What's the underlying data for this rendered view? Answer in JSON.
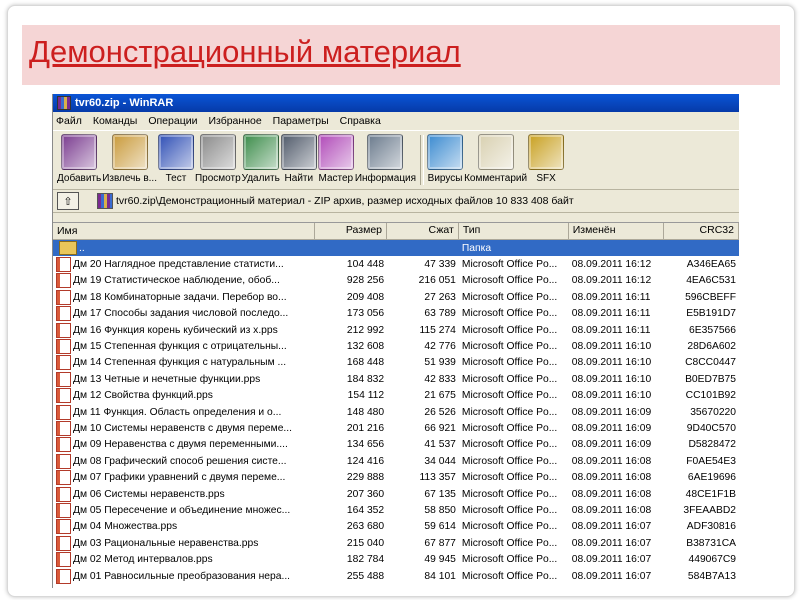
{
  "slide": {
    "title": "Демонстрационный материал"
  },
  "window": {
    "title": "tvr60.zip - WinRAR"
  },
  "menu": [
    "Файл",
    "Команды",
    "Операции",
    "Избранное",
    "Параметры",
    "Справка"
  ],
  "toolbar": [
    {
      "label": "Добавить",
      "icon": "add-archive-icon",
      "color": "#7a3b8f"
    },
    {
      "label": "Извлечь в...",
      "icon": "extract-icon",
      "color": "#c99a3a"
    },
    {
      "label": "Тест",
      "icon": "test-icon",
      "color": "#2f4fb5"
    },
    {
      "label": "Просмотр",
      "icon": "view-icon",
      "color": "#8a8a8a"
    },
    {
      "label": "Удалить",
      "icon": "delete-icon",
      "color": "#3c8c4a"
    },
    {
      "label": "Найти",
      "icon": "find-icon",
      "color": "#505a6a"
    },
    {
      "label": "Мастер",
      "icon": "wizard-icon",
      "color": "#b04ab8"
    },
    {
      "label": "Информация",
      "icon": "info-icon",
      "color": "#6a7a8c"
    },
    {
      "label": "Вирусы",
      "icon": "virus-icon",
      "color": "#3a8ad0"
    },
    {
      "label": "Комментарий",
      "icon": "comment-icon",
      "color": "#d8d0b0"
    },
    {
      "label": "SFX",
      "icon": "sfx-icon",
      "color": "#c8a020"
    }
  ],
  "address": {
    "up_label": "⇧",
    "path": "tvr60.zip\\Демонстрационный материал - ZIP архив, размер исходных файлов 10 833 408 байт"
  },
  "columns": {
    "name": "Имя",
    "size": "Размер",
    "packed": "Сжат",
    "type": "Тип",
    "modified": "Изменён",
    "crc": "CRC32"
  },
  "parent_row": {
    "name": "..",
    "type": "Папка"
  },
  "files": [
    {
      "name": "Дм 20 Наглядное представление статисти...",
      "size": "104 448",
      "packed": "47 339",
      "type": "Microsoft Office Po...",
      "modified": "08.09.2011 16:12",
      "crc": "A346EA65"
    },
    {
      "name": "Дм 19 Статистическое наблюдение, обоб...",
      "size": "928 256",
      "packed": "216 051",
      "type": "Microsoft Office Po...",
      "modified": "08.09.2011 16:12",
      "crc": "4EA6C531"
    },
    {
      "name": "Дм 18 Комбинаторные задачи. Перебор во...",
      "size": "209 408",
      "packed": "27 263",
      "type": "Microsoft Office Po...",
      "modified": "08.09.2011 16:11",
      "crc": "596CBEFF"
    },
    {
      "name": "Дм 17 Способы задания числовой последо...",
      "size": "173 056",
      "packed": "63 789",
      "type": "Microsoft Office Po...",
      "modified": "08.09.2011 16:11",
      "crc": "E5B191D7"
    },
    {
      "name": "Дм 16 Функция корень кубический из x.pps",
      "size": "212 992",
      "packed": "115 274",
      "type": "Microsoft Office Po...",
      "modified": "08.09.2011 16:11",
      "crc": "6E357566"
    },
    {
      "name": "Дм 15 Степенная функция с отрицательны...",
      "size": "132 608",
      "packed": "42 776",
      "type": "Microsoft Office Po...",
      "modified": "08.09.2011 16:10",
      "crc": "28D6A602"
    },
    {
      "name": "Дм 14 Степенная функция с натуральным ...",
      "size": "168 448",
      "packed": "51 939",
      "type": "Microsoft Office Po...",
      "modified": "08.09.2011 16:10",
      "crc": "C8CC0447"
    },
    {
      "name": "Дм 13 Четные и нечетные функции.pps",
      "size": "184 832",
      "packed": "42 833",
      "type": "Microsoft Office Po...",
      "modified": "08.09.2011 16:10",
      "crc": "B0ED7B75"
    },
    {
      "name": "Дм 12 Свойства функций.pps",
      "size": "154 112",
      "packed": "21 675",
      "type": "Microsoft Office Po...",
      "modified": "08.09.2011 16:10",
      "crc": "CC101B92"
    },
    {
      "name": "Дм 11 Функция. Область определения и о...",
      "size": "148 480",
      "packed": "26 526",
      "type": "Microsoft Office Po...",
      "modified": "08.09.2011 16:09",
      "crc": "35670220"
    },
    {
      "name": "Дм 10 Системы неравенств с двумя переме...",
      "size": "201 216",
      "packed": "66 921",
      "type": "Microsoft Office Po...",
      "modified": "08.09.2011 16:09",
      "crc": "9D40C570"
    },
    {
      "name": "Дм 09 Неравенства с двумя переменными....",
      "size": "134 656",
      "packed": "41 537",
      "type": "Microsoft Office Po...",
      "modified": "08.09.2011 16:09",
      "crc": "D5828472"
    },
    {
      "name": "Дм 08 Графический способ решения систе...",
      "size": "124 416",
      "packed": "34 044",
      "type": "Microsoft Office Po...",
      "modified": "08.09.2011 16:08",
      "crc": "F0AE54E3"
    },
    {
      "name": "Дм 07 Графики уравнений с двумя переме...",
      "size": "229 888",
      "packed": "113 357",
      "type": "Microsoft Office Po...",
      "modified": "08.09.2011 16:08",
      "crc": "6AE19696"
    },
    {
      "name": "Дм 06 Системы неравенств.pps",
      "size": "207 360",
      "packed": "67 135",
      "type": "Microsoft Office Po...",
      "modified": "08.09.2011 16:08",
      "crc": "48CE1F1B"
    },
    {
      "name": "Дм 05 Пересечение и объединение множес...",
      "size": "164 352",
      "packed": "58 850",
      "type": "Microsoft Office Po...",
      "modified": "08.09.2011 16:08",
      "crc": "3FEAABD2"
    },
    {
      "name": "Дм 04 Множества.pps",
      "size": "263 680",
      "packed": "59 614",
      "type": "Microsoft Office Po...",
      "modified": "08.09.2011 16:07",
      "crc": "ADF30816"
    },
    {
      "name": "Дм 03 Рациональные неравенства.pps",
      "size": "215 040",
      "packed": "67 877",
      "type": "Microsoft Office Po...",
      "modified": "08.09.2011 16:07",
      "crc": "B38731CA"
    },
    {
      "name": "Дм 02 Метод интервалов.pps",
      "size": "182 784",
      "packed": "49 945",
      "type": "Microsoft Office Po...",
      "modified": "08.09.2011 16:07",
      "crc": "449067C9"
    },
    {
      "name": "Дм 01 Равносильные преобразования нера...",
      "size": "255 488",
      "packed": "84 101",
      "type": "Microsoft Office Po...",
      "modified": "08.09.2011 16:07",
      "crc": "584B7A13"
    }
  ]
}
